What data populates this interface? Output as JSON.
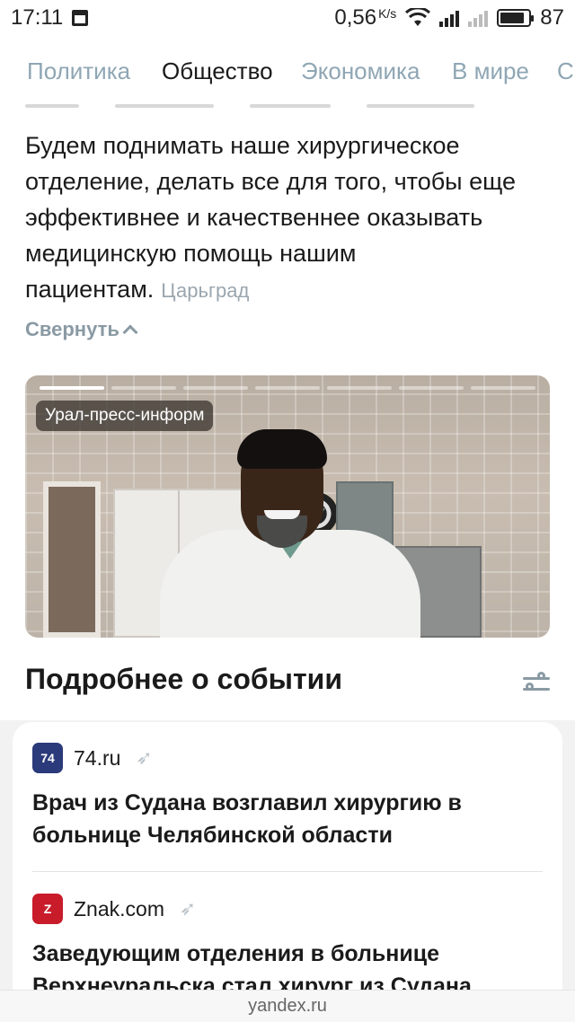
{
  "status_bar": {
    "time": "17:11",
    "net_speed": "0,56",
    "net_unit": "K/s",
    "battery": "87",
    "battery_level": 0.87
  },
  "tabs": [
    "Политика",
    "Общество",
    "Экономика",
    "В мире",
    "С"
  ],
  "active_tab": "Общество",
  "quote": {
    "text": "Будем поднимать наше хирургическое отделение, делать все для того, чтобы еще эффективнее и качественнее оказывать медицинскую помощь нашим пациентам.",
    "source": "Царьград"
  },
  "collapse_label": "Свернуть",
  "media": {
    "badge": "Урал-пресс-информ",
    "progress_total": 7,
    "progress_active": 1
  },
  "section_title": "Подробнее о событии",
  "news": [
    {
      "source": "74.ru",
      "logo_text": "74",
      "logo_color": "#2b3a7a",
      "headline": "Врач из Судана возглавил хирургию в больнице Челябинской области"
    },
    {
      "source": "Znak.com",
      "logo_text": "Z",
      "logo_color": "#c81c2b",
      "headline": "Заведующим отделения в больнице Верхнеуральска стал хирург из Судана"
    }
  ],
  "url": "yandex.ru",
  "icons": {
    "calendar": "calendar-icon",
    "wifi": "wifi-icon",
    "signal": "signal-icon",
    "battery": "battery-icon",
    "chevron": "chevron-up-icon",
    "filter": "filter-sliders-icon",
    "rocket": "rocket-icon"
  }
}
